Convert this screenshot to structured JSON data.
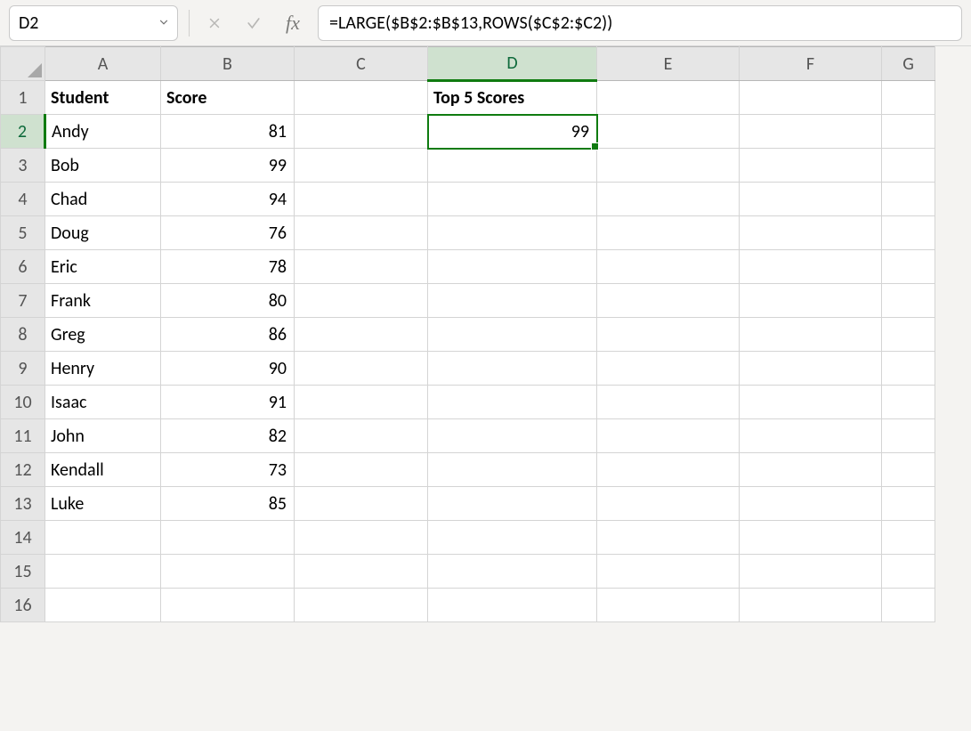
{
  "active_cell_ref": "D2",
  "formula": "=LARGE($B$2:$B$13,ROWS($C$2:$C2))",
  "columns": [
    "A",
    "B",
    "C",
    "D",
    "E",
    "F",
    "G"
  ],
  "row_count": 16,
  "selected_col": "D",
  "selected_row": 2,
  "headers": {
    "student": "Student",
    "score": "Score",
    "top5": "Top 5 Scores"
  },
  "students": [
    {
      "name": "Andy",
      "score": 81
    },
    {
      "name": "Bob",
      "score": 99
    },
    {
      "name": "Chad",
      "score": 94
    },
    {
      "name": "Doug",
      "score": 76
    },
    {
      "name": "Eric",
      "score": 78
    },
    {
      "name": "Frank",
      "score": 80
    },
    {
      "name": "Greg",
      "score": 86
    },
    {
      "name": "Henry",
      "score": 90
    },
    {
      "name": "Isaac",
      "score": 91
    },
    {
      "name": "John",
      "score": 82
    },
    {
      "name": "Kendall",
      "score": 73
    },
    {
      "name": "Luke",
      "score": 85
    }
  ],
  "top5": {
    "row2": 99
  }
}
